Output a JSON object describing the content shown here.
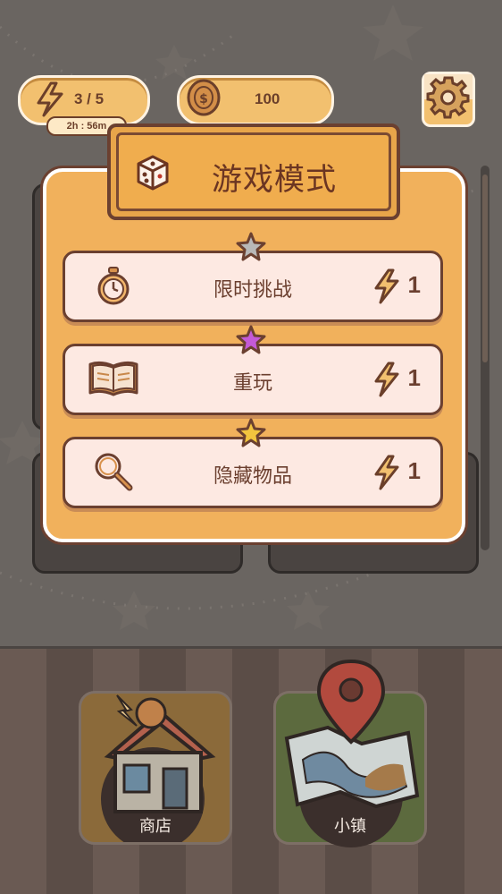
{
  "hud": {
    "energy": {
      "value": "3 / 5",
      "timer": "2h : 56m",
      "icon": "lightning-icon"
    },
    "coins": {
      "value": "100",
      "icon": "coin-icon"
    },
    "settings": {
      "icon": "gear-icon"
    }
  },
  "modal": {
    "title": "游戏模式",
    "icon": "dice-icon",
    "modes": [
      {
        "label": "限时挑战",
        "cost": "1",
        "icon": "stopwatch-icon",
        "star_color": "#b8b8b8"
      },
      {
        "label": "重玩",
        "cost": "1",
        "icon": "book-icon",
        "star_color": "#c45ad8"
      },
      {
        "label": "隐藏物品",
        "cost": "1",
        "icon": "magnifier-icon",
        "star_color": "#f2c43e"
      }
    ]
  },
  "bottom_nav": {
    "shop": {
      "label": "商店",
      "icon": "shop-house-icon"
    },
    "town": {
      "label": "小镇",
      "icon": "map-pin-icon"
    }
  },
  "colors": {
    "accent_orange": "#f1b15c",
    "button_bg": "#fde9e2",
    "dark_brown": "#6b4030"
  }
}
